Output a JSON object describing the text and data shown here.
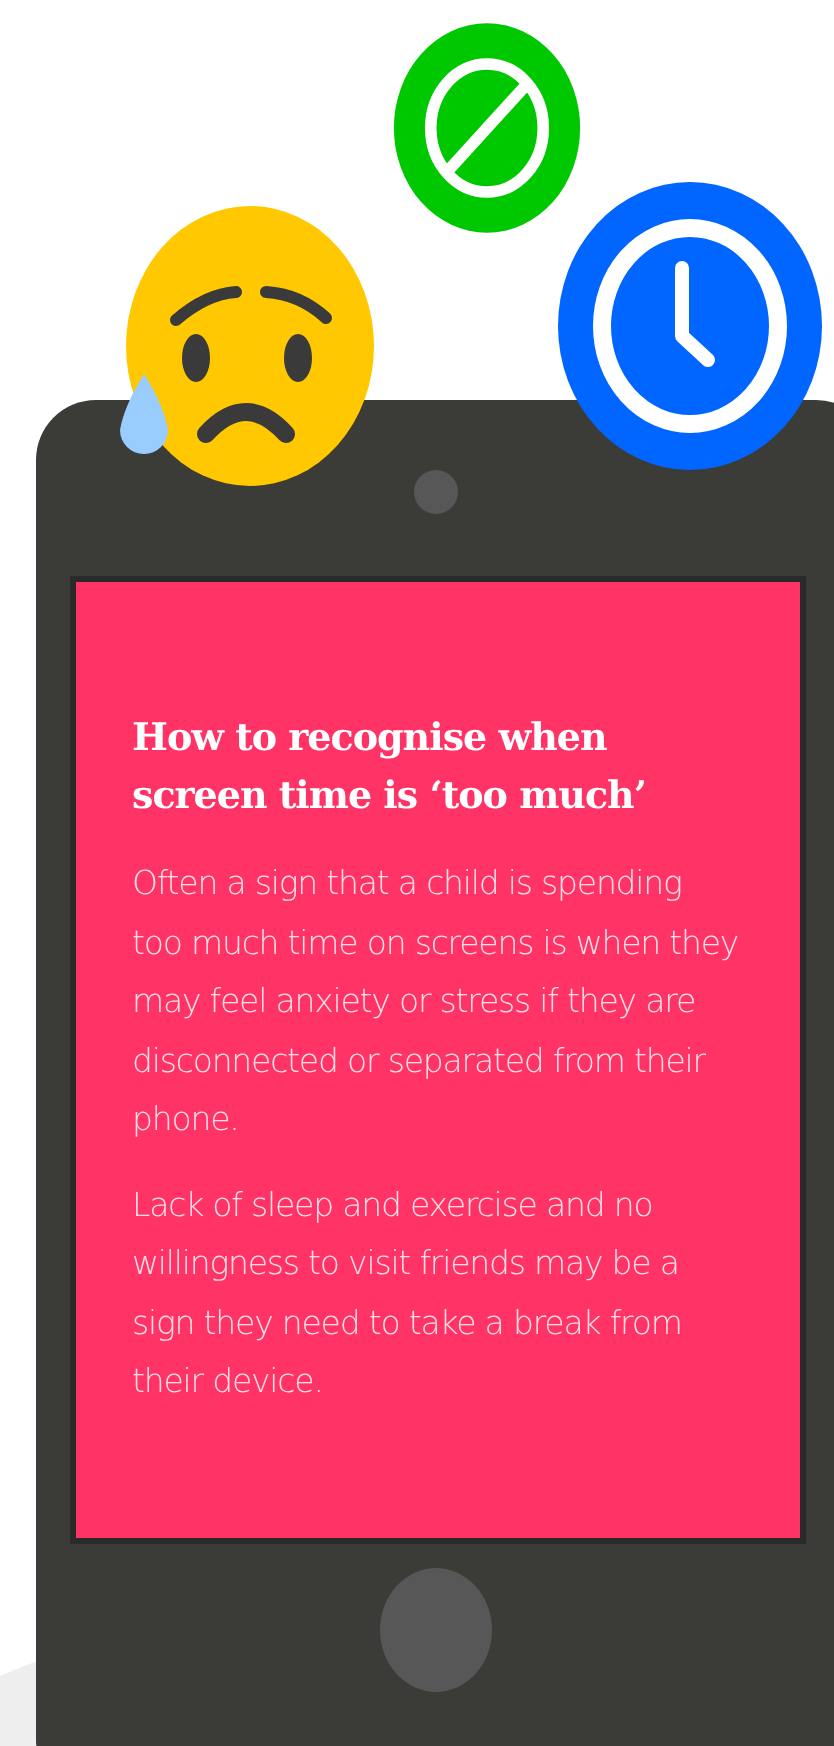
{
  "card": {
    "title": "How to recognise when screen time is ‘too much’",
    "paragraphs": [
      "Often a sign that a child is spending too much time on screens is when they may feel anxiety or stress if they are disconnected or separated from their phone.",
      "Lack of sleep and exercise and no willingness to visit friends may be a sign they need to take a break from their device."
    ]
  }
}
